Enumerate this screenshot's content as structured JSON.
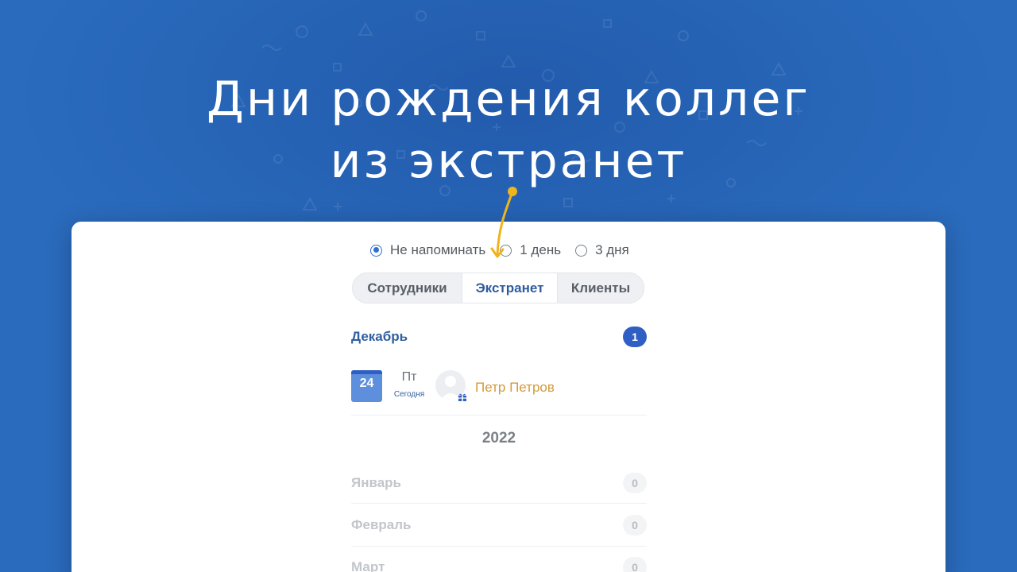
{
  "headline": {
    "line1": "Дни рождения коллег",
    "line2": "из экстранет"
  },
  "colors": {
    "background": "#2a6bbd",
    "accent": "#2f5fc4",
    "arrow": "#f0b41c",
    "person_link": "#d49a3a"
  },
  "reminder": {
    "options": [
      {
        "label": "Не напоминать",
        "selected": true
      },
      {
        "label": "1 день",
        "selected": false
      },
      {
        "label": "3 дня",
        "selected": false
      }
    ]
  },
  "tabs": [
    {
      "label": "Сотрудники",
      "active": false
    },
    {
      "label": "Экстранет",
      "active": true
    },
    {
      "label": "Клиенты",
      "active": false
    }
  ],
  "current_month": {
    "name": "Декабрь",
    "count": "1",
    "entry": {
      "day": "24",
      "weekday": "Пт",
      "relative": "Сегодня",
      "person": "Петр Петров"
    }
  },
  "year": "2022",
  "months": [
    {
      "name": "Январь",
      "count": "0"
    },
    {
      "name": "Февраль",
      "count": "0"
    },
    {
      "name": "Март",
      "count": "0"
    }
  ]
}
